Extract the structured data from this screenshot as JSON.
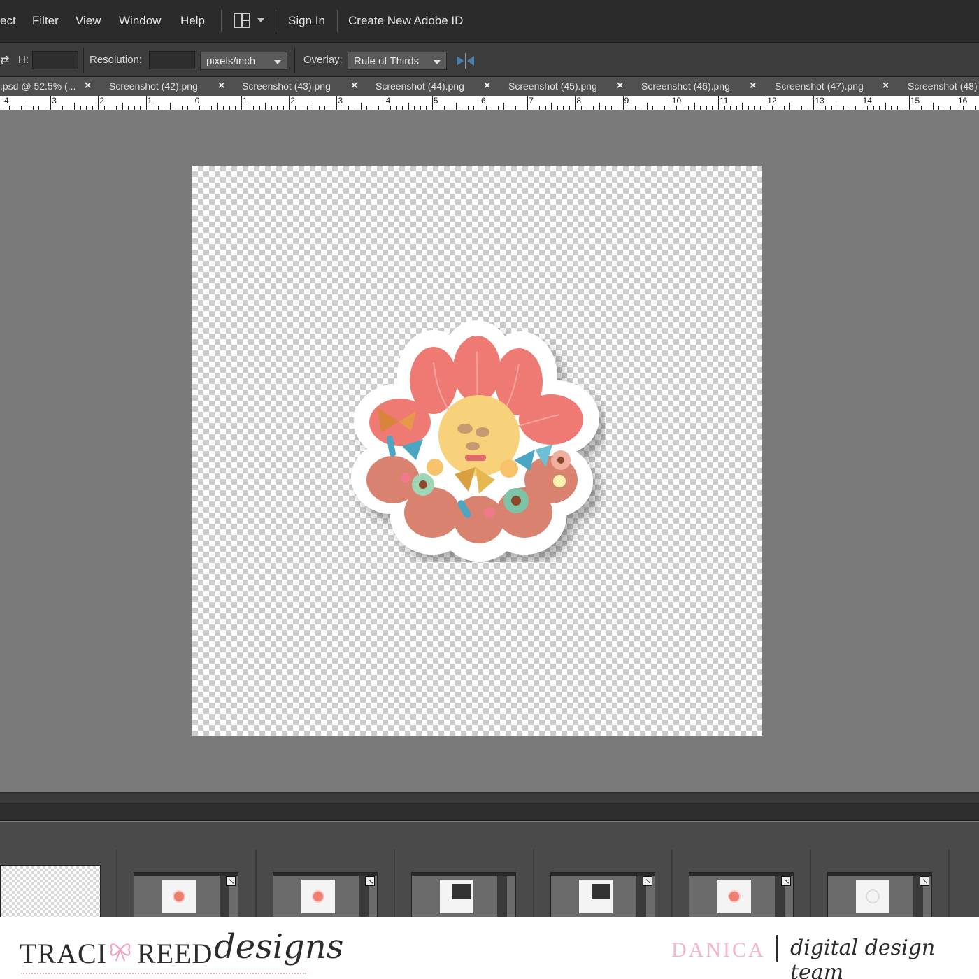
{
  "menubar": {
    "items": [
      "ect",
      "Filter",
      "View",
      "Window",
      "Help"
    ],
    "sign_in": "Sign In",
    "create_id": "Create New Adobe ID"
  },
  "options": {
    "h_label": "H:",
    "resolution_label": "Resolution:",
    "units_value": "pixels/inch",
    "overlay_label": "Overlay:",
    "overlay_value": "Rule of Thirds"
  },
  "tabs": [
    ".psd @ 52.5% (...",
    "Screenshot (42).png",
    "Screenshot (43).png",
    "Screenshot (44).png",
    "Screenshot (45).png",
    "Screenshot (46).png",
    "Screenshot (47).png",
    "Screenshot (48)"
  ],
  "ruler": {
    "labels": [
      "4",
      "3",
      "2",
      "1",
      "0",
      "1",
      "2",
      "3",
      "4",
      "5",
      "6",
      "7",
      "8",
      "9",
      "10",
      "11",
      "12",
      "13",
      "14",
      "15",
      "16"
    ]
  },
  "canvas": {
    "background": "transparent-checkerboard",
    "artwork": "flower-sticker"
  },
  "photo_bin": {
    "thumbnails": [
      "flower",
      "flower",
      "dialog",
      "dialog",
      "flower",
      "ring"
    ]
  },
  "footer": {
    "brand_part1": "TRACI",
    "brand_part2": "REED",
    "brand_script": "designs",
    "designer": "DANICA",
    "team": "digital design team"
  },
  "colors": {
    "accent_pink": "#f5b6ca",
    "petal": "#ee7a73",
    "center": "#f8d27a"
  }
}
